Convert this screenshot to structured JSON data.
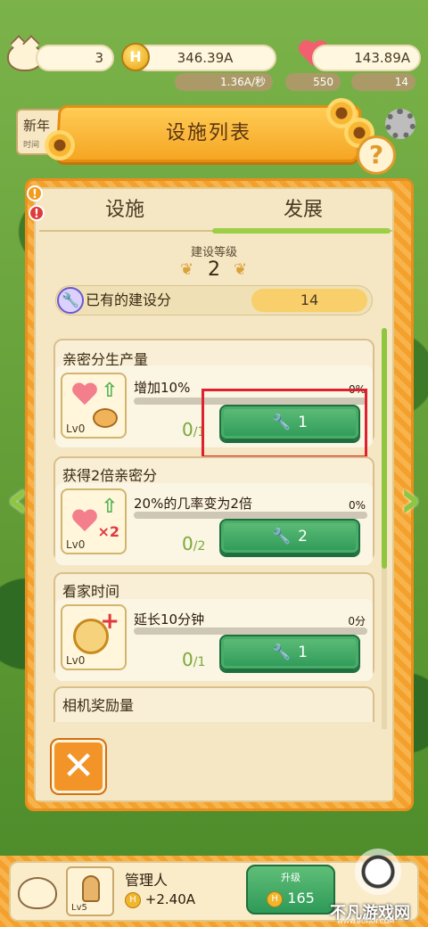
{
  "top_bar": {
    "cats": "3",
    "coins": "346.39A",
    "income_rate": "1.36A/秒",
    "hearts": "143.89A",
    "gems": "550",
    "wrenches": "14",
    "coin_symbol": "H"
  },
  "bg_stub": {
    "label": "新年",
    "sub": "时间"
  },
  "panel": {
    "title": "设施列表",
    "help": "?",
    "tabs": [
      {
        "label": "设施",
        "active": false
      },
      {
        "label": "发展",
        "active": true
      }
    ],
    "construction_level_label": "建设等级",
    "construction_level": "2",
    "points_label": "已有的建设分",
    "points_value": "14"
  },
  "facilities": [
    {
      "title": "亲密分生产量",
      "level": "Lv0",
      "effect": "增加10%",
      "progress": "0%",
      "count": "0",
      "max": "1",
      "cost": "1",
      "highlighted": true
    },
    {
      "title": "获得2倍亲密分",
      "level": "Lv0",
      "effect": "20%的几率变为2倍",
      "progress": "0%",
      "count": "0",
      "max": "2",
      "cost": "2",
      "highlighted": false
    },
    {
      "title": "看家时间",
      "level": "Lv0",
      "effect": "延长10分钟",
      "progress": "0分",
      "count": "0",
      "max": "1",
      "cost": "1",
      "highlighted": false
    },
    {
      "title": "相机奖励量"
    }
  ],
  "close_label": "✕",
  "nav": {
    "prev": "‹",
    "next": "›"
  },
  "manager": {
    "name": "管理人",
    "level": "Lv5",
    "rate": "+2.40A",
    "upgrade_label": "升级",
    "upgrade_cost": "165"
  },
  "watermark": {
    "text": "不凡游戏网",
    "sub": "WWW.BUFAN.COM"
  }
}
